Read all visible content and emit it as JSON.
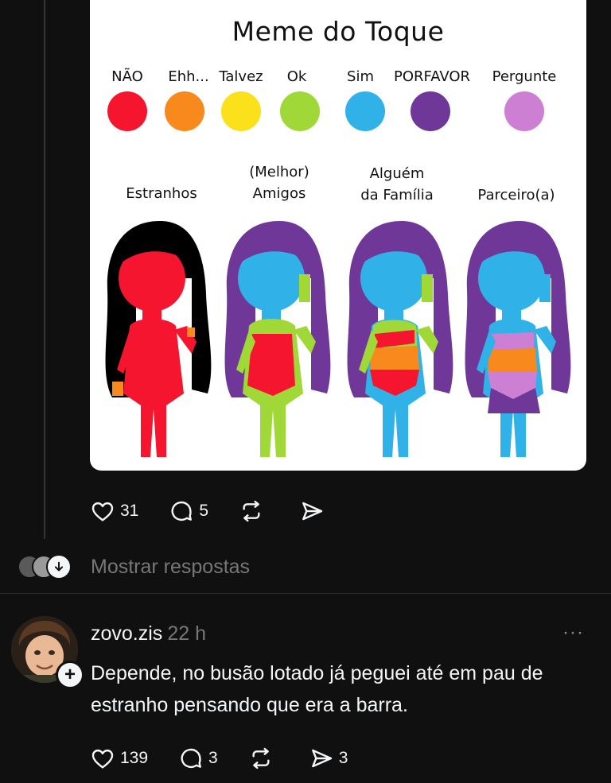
{
  "meme": {
    "title": "Meme do Toque",
    "levels": [
      {
        "label": "NÃO",
        "color": "#f5152e"
      },
      {
        "label": "Ehh...",
        "color": "#f8891c"
      },
      {
        "label": "Talvez",
        "color": "#fbe01c"
      },
      {
        "label": "Ok",
        "color": "#9fd837"
      },
      {
        "label": "Sim",
        "color": "#30b2e8"
      },
      {
        "label": "PORFAVOR",
        "color": "#6f3797"
      },
      {
        "label": "Pergunte",
        "color": "#cc7fd3"
      }
    ],
    "relationships": [
      {
        "line1": "",
        "line2": "Estranhos"
      },
      {
        "line1": "(Melhor)",
        "line2": "Amigos"
      },
      {
        "line1": "Alguém",
        "line2": "da Família"
      },
      {
        "line1": "",
        "line2": "Parceiro(a)"
      }
    ]
  },
  "post_actions": {
    "likes": "31",
    "comments": "5",
    "reposts": "",
    "shares": ""
  },
  "show_replies": {
    "label": "Mostrar respostas"
  },
  "reply": {
    "username": "zovo.zis",
    "time": "22 h",
    "more": "···",
    "text": "Depende, no busão lotado já peguei até em pau de estranho pensando que era a barra.",
    "likes": "139",
    "comments": "3",
    "shares": "3"
  },
  "icons": {
    "like": "heart-icon",
    "comment": "comment-bubble-icon",
    "repost": "repost-icon",
    "share": "send-icon",
    "follow": "plus-icon",
    "expand": "arrow-down-icon"
  }
}
